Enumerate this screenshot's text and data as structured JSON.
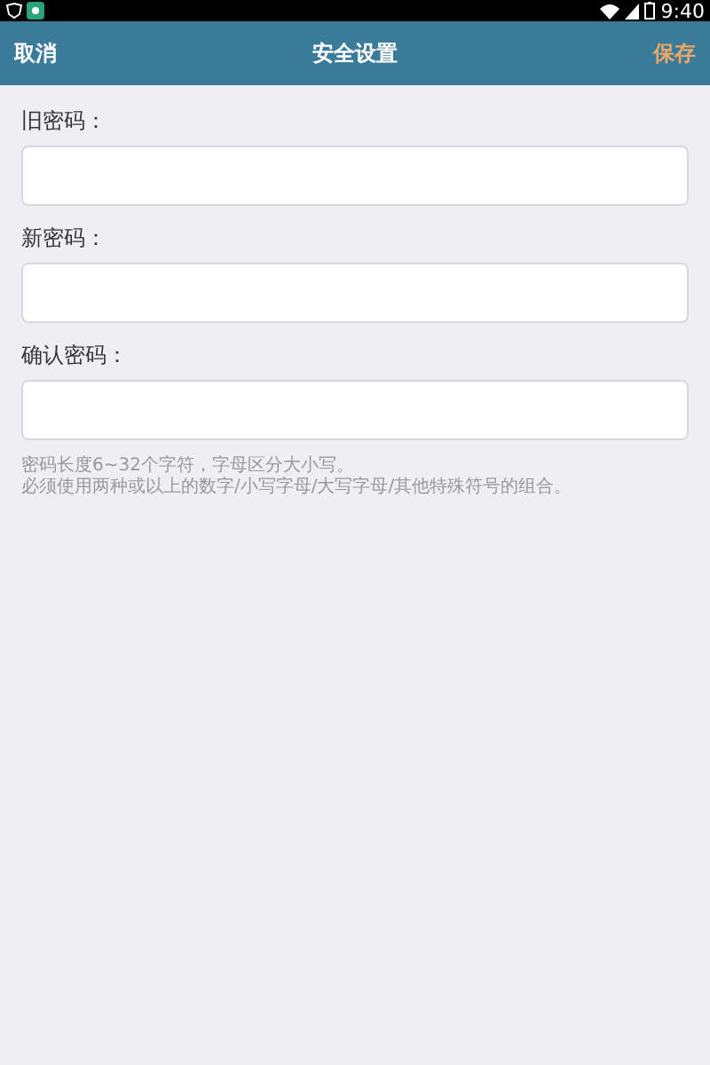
{
  "status_bar": {
    "time": "9:40"
  },
  "header": {
    "cancel": "取消",
    "title": "安全设置",
    "save": "保存"
  },
  "fields": [
    {
      "label": "旧密码："
    },
    {
      "label": "新密码："
    },
    {
      "label": "确认密码："
    }
  ],
  "hints": [
    "密码长度6~32个字符，字母区分大小写。",
    "必须使用两种或以上的数字/小写字母/大写字母/其他特殊符号的组合。"
  ]
}
